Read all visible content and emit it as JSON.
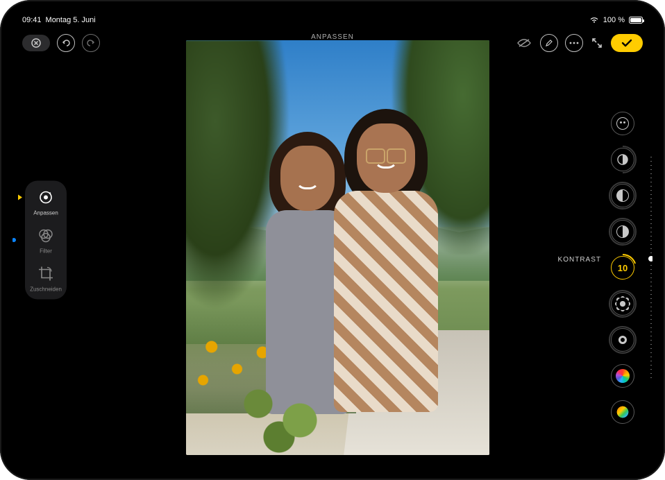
{
  "status": {
    "time": "09:41",
    "date": "Montag 5. Juni",
    "battery_text": "100 %"
  },
  "toolbar": {
    "mode_title": "ANPASSEN"
  },
  "dock": {
    "items": [
      {
        "label": "Anpassen"
      },
      {
        "label": "Filter"
      },
      {
        "label": "Zuschneiden"
      }
    ]
  },
  "adjust": {
    "selected_label": "KONTRAST",
    "selected_value": "10"
  }
}
